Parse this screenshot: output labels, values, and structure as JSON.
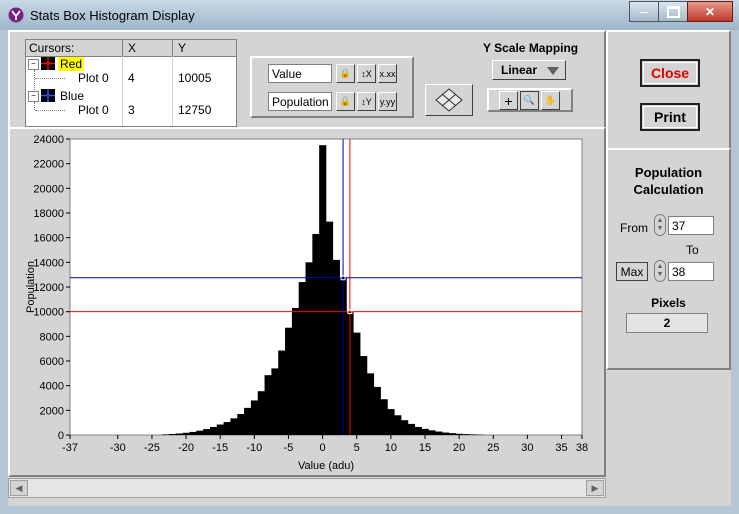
{
  "window": {
    "title": "Stats Box Histogram Display"
  },
  "cursors": {
    "header": {
      "name": "Cursors:",
      "x": "X",
      "y": "Y"
    },
    "items": [
      {
        "label": "Red",
        "color": "#ff0000",
        "plot": "Plot 0",
        "x": "4",
        "y": "10005"
      },
      {
        "label": "Blue",
        "color": "#0000ff",
        "plot": "Plot 0",
        "x": "3",
        "y": "12750"
      }
    ]
  },
  "axes_controls": {
    "x_name": "Value",
    "y_name": "Population"
  },
  "y_scale": {
    "label": "Y Scale Mapping",
    "selected": "Linear"
  },
  "buttons": {
    "close": "Close",
    "print": "Print"
  },
  "population_calc": {
    "title_line1": "Population",
    "title_line2": "Calculation",
    "from_label": "From",
    "from_value": "37",
    "to_label": "To",
    "max_label": "Max",
    "to_value": "38",
    "pixels_label": "Pixels",
    "pixels_value": "2"
  },
  "chart_data": {
    "type": "bar",
    "xlabel": "Value (adu)",
    "ylabel": "Population",
    "xlim": [
      -37,
      38
    ],
    "ylim": [
      0,
      24000
    ],
    "x_ticks": [
      -37,
      -30,
      -25,
      -20,
      -15,
      -10,
      -5,
      0,
      5,
      10,
      15,
      20,
      25,
      30,
      35,
      38
    ],
    "y_ticks": [
      0,
      2000,
      4000,
      6000,
      8000,
      10000,
      12000,
      14000,
      16000,
      18000,
      20000,
      22000,
      24000
    ],
    "bins_x": [
      -23,
      -22,
      -21,
      -20,
      -19,
      -18,
      -17,
      -16,
      -15,
      -14,
      -13,
      -12,
      -11,
      -10,
      -9,
      -8,
      -7,
      -6,
      -5,
      -4,
      -3,
      -2,
      -1,
      0,
      1,
      2,
      3,
      4,
      5,
      6,
      7,
      8,
      9,
      10,
      11,
      12,
      13,
      14,
      15,
      16,
      17,
      18,
      19,
      20,
      21,
      22,
      23
    ],
    "values": [
      50,
      80,
      120,
      180,
      250,
      350,
      480,
      650,
      850,
      1050,
      1350,
      1700,
      2200,
      2800,
      3550,
      4850,
      5400,
      6850,
      8700,
      10300,
      12400,
      14000,
      16300,
      23500,
      17300,
      14200,
      12800,
      10000,
      8300,
      6400,
      5000,
      3900,
      2900,
      2100,
      1600,
      1200,
      900,
      650,
      500,
      380,
      280,
      200,
      150,
      100,
      70,
      50,
      30
    ],
    "cursors": [
      {
        "name": "Red",
        "x": 4,
        "y": 10005,
        "color": "#ff0000"
      },
      {
        "name": "Blue",
        "x": 3,
        "y": 12750,
        "color": "#0000aa"
      }
    ],
    "grid": false
  }
}
